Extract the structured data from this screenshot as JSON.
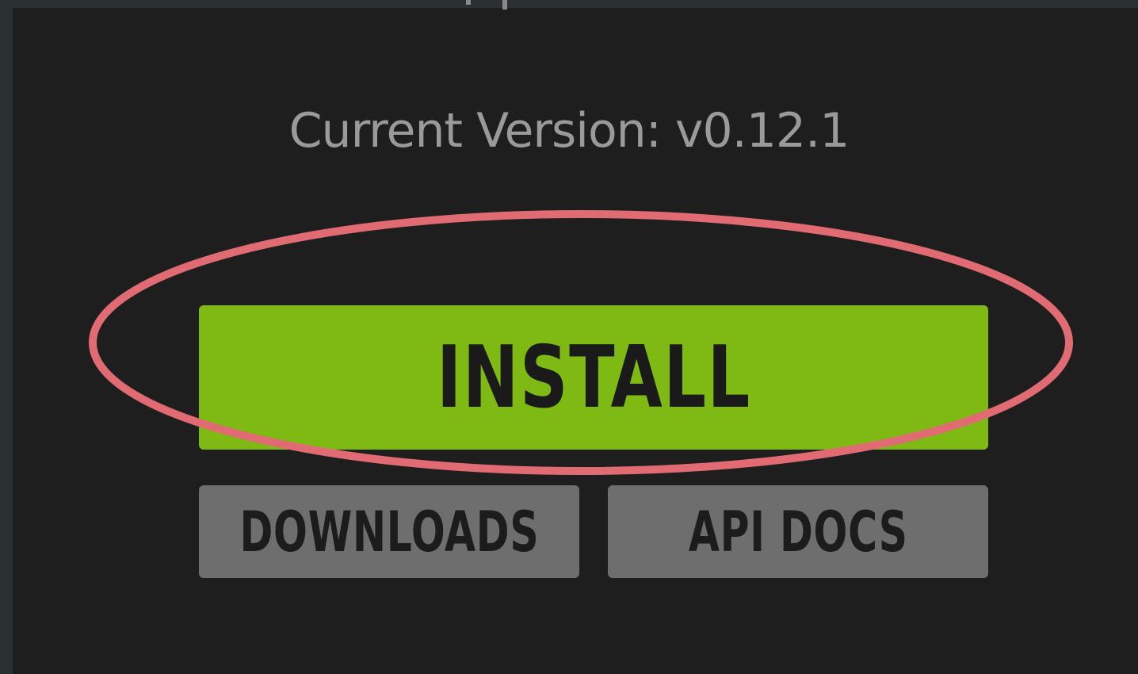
{
  "version": {
    "text": "Current Version: v0.12.1"
  },
  "buttons": {
    "install_label": "INSTALL",
    "downloads_label": "DOWNLOADS",
    "api_docs_label": "API DOCS"
  },
  "colors": {
    "install_bg": "#7fba14",
    "secondary_bg": "#6e6e6e",
    "panel_bg": "#1e1e1e",
    "annotation_ring": "#e06b73"
  }
}
